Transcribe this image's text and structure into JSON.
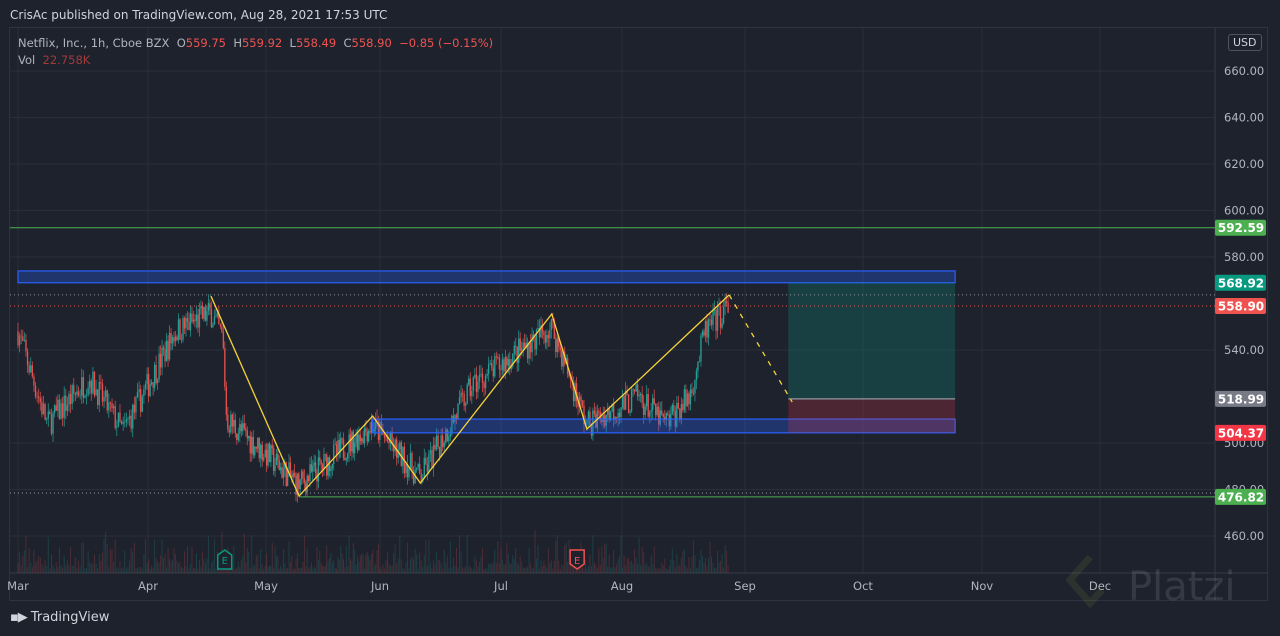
{
  "header": {
    "published": "CrisAc published on TradingView.com, Aug 28, 2021 17:53 UTC"
  },
  "legend": {
    "symbol": "Netflix, Inc., 1h, Cboe BZX",
    "open_label": "O",
    "open": "559.75",
    "high_label": "H",
    "high": "559.92",
    "low_label": "L",
    "low": "558.49",
    "close_label": "C",
    "close": "558.90",
    "change": "−0.85 (−0.15%)",
    "vol_label": "Vol",
    "vol": "22.758K"
  },
  "currency_button": "USD",
  "footer": {
    "brand": "TradingView",
    "watermark": "Platzi"
  },
  "colors": {
    "up": "#26a69a",
    "down": "#ef5350",
    "zigzag": "#f5d33a",
    "zone": "#2962ff",
    "target": "#4caf50",
    "stop": "#f23645"
  },
  "chart_data": {
    "type": "candlestick",
    "ylim": [
      445,
      672
    ],
    "y_ticks": [
      "660.00",
      "640.00",
      "620.00",
      "600.00",
      "580.00",
      "540.00",
      "500.00",
      "480.00",
      "460.00"
    ],
    "x_ticks": [
      "Mar",
      "Apr",
      "May",
      "Jun",
      "Jul",
      "Aug",
      "Sep",
      "Oct",
      "Nov",
      "Dec"
    ],
    "approx_close_path": [
      {
        "date": "2021-03-01",
        "price": 548
      },
      {
        "date": "2021-03-08",
        "price": 508
      },
      {
        "date": "2021-03-18",
        "price": 528
      },
      {
        "date": "2021-03-26",
        "price": 505
      },
      {
        "date": "2021-04-08",
        "price": 548
      },
      {
        "date": "2021-04-17",
        "price": 556
      },
      {
        "date": "2021-04-20",
        "price": 545
      },
      {
        "date": "2021-04-21",
        "price": 510
      },
      {
        "date": "2021-05-10",
        "price": 482
      },
      {
        "date": "2021-05-30",
        "price": 508
      },
      {
        "date": "2021-06-11",
        "price": 485
      },
      {
        "date": "2021-06-24",
        "price": 525
      },
      {
        "date": "2021-07-14",
        "price": 550
      },
      {
        "date": "2021-07-23",
        "price": 508
      },
      {
        "date": "2021-08-05",
        "price": 520
      },
      {
        "date": "2021-08-12",
        "price": 508
      },
      {
        "date": "2021-08-18",
        "price": 520
      },
      {
        "date": "2021-08-22",
        "price": 548
      },
      {
        "date": "2021-08-28",
        "price": 558.9
      }
    ],
    "earnings_markers": [
      {
        "date": "2021-04-20",
        "label": "E",
        "type": "past"
      },
      {
        "date": "2021-07-20",
        "label": "E",
        "type": "past-miss"
      }
    ],
    "drawings": {
      "zigzag": [
        {
          "date": "2021-04-17",
          "price": 563.2
        },
        {
          "date": "2021-05-10",
          "price": 477.2
        },
        {
          "date": "2021-05-30",
          "price": 511.6
        },
        {
          "date": "2021-06-11",
          "price": 482.8
        },
        {
          "date": "2021-07-14",
          "price": 555.5
        },
        {
          "date": "2021-07-23",
          "price": 506.0
        },
        {
          "date": "2021-08-28",
          "price": 563.7
        }
      ],
      "projection": [
        {
          "date": "2021-08-28",
          "price": 563.7
        },
        {
          "date": "2021-09-13",
          "price": 517.6
        }
      ],
      "resistance_zone": {
        "from": "2021-03-01",
        "to": "2021-10-25",
        "top": 574.0,
        "bottom": 568.92
      },
      "support_zone": {
        "from": "2021-05-30",
        "to": "2021-10-25",
        "top": 510.3,
        "bottom": 504.37
      },
      "position": {
        "from": "2021-09-12",
        "to": "2021-10-25",
        "target": 568.92,
        "entry": 518.99,
        "stop": 504.37
      },
      "hlines": [
        {
          "price": 592.59,
          "color": "#4caf50"
        },
        {
          "price": 476.82,
          "color": "#4caf50",
          "from": "2021-05-10"
        }
      ]
    },
    "price_labels": [
      {
        "text": "592.59",
        "price": 592.59,
        "color": "#4caf50"
      },
      {
        "text": "568.92",
        "price": 568.92,
        "color": "#089981"
      },
      {
        "text": "558.90",
        "price": 558.9,
        "color": "#ef5350"
      },
      {
        "text": "518.99",
        "price": 518.99,
        "color": "#787b86"
      },
      {
        "text": "504.37",
        "price": 504.37,
        "color": "#f23645"
      },
      {
        "text": "476.82",
        "price": 476.82,
        "color": "#4caf50"
      }
    ]
  }
}
